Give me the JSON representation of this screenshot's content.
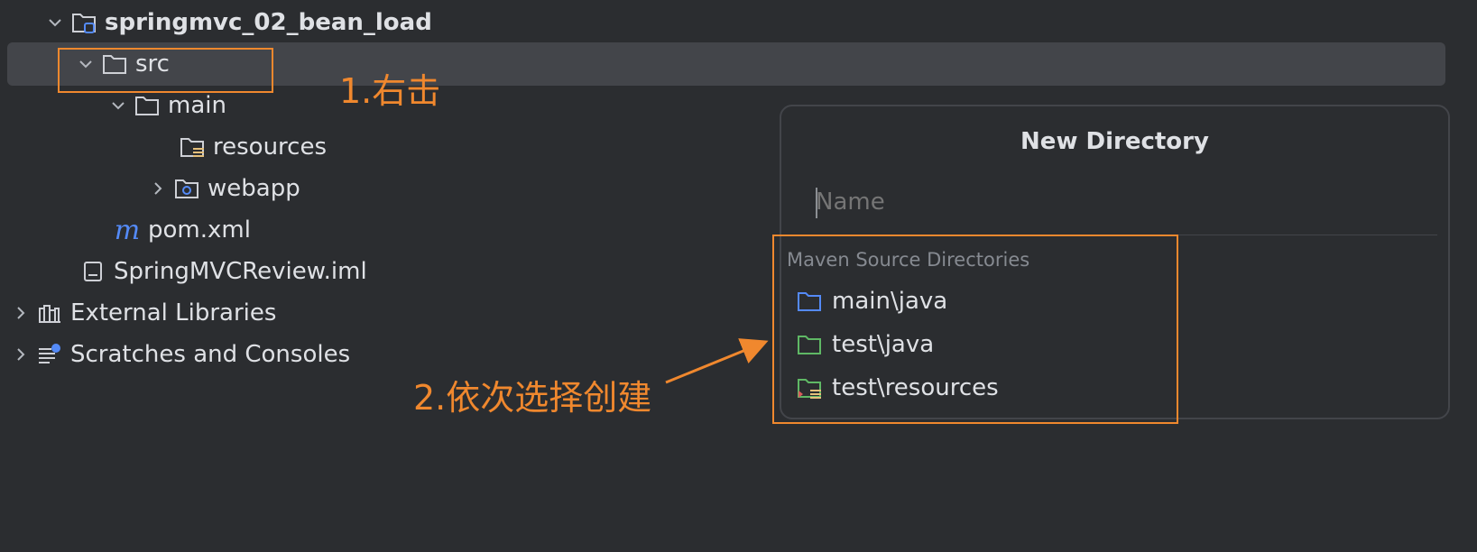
{
  "tree": {
    "project_root": "springmvc_02_bean_load",
    "src": "src",
    "main": "main",
    "resources": "resources",
    "webapp": "webapp",
    "pom_icon": "m",
    "pom": "pom.xml",
    "iml": "SpringMVCReview.iml",
    "external_libraries": "External Libraries",
    "scratches": "Scratches and Consoles"
  },
  "annotations": {
    "step1": "1.右击",
    "step2": "2.依次选择创建"
  },
  "popup": {
    "title": "New Directory",
    "name_placeholder": "Name",
    "group_label": "Maven Source Directories",
    "items": [
      {
        "label": "main\\java",
        "icon": "folder-blue-icon"
      },
      {
        "label": "test\\java",
        "icon": "folder-green-icon"
      },
      {
        "label": "test\\resources",
        "icon": "folder-test-resources-icon"
      }
    ]
  },
  "colors": {
    "background": "#2b2d30",
    "selection": "#43454a",
    "text": "#dfe1e5",
    "annotation": "#f0882e",
    "folder_blue": "#548af7",
    "folder_green": "#5fb865"
  }
}
